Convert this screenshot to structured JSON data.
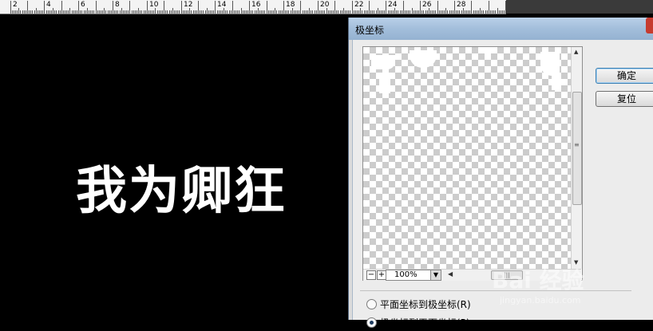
{
  "ruler": {
    "numbers": [
      "2",
      "4",
      "6",
      "8",
      "10",
      "12",
      "14",
      "16",
      "18",
      "20",
      "22",
      "24",
      "26",
      "28"
    ]
  },
  "canvas": {
    "text": "我为卿狂"
  },
  "dialog": {
    "title": "极坐标",
    "zoom_value": "100%",
    "zoom_out_label": "−",
    "zoom_in_label": "+",
    "hscroll_grip": "|||",
    "vscroll_grip": "≡",
    "option_rect_to_polar": "平面坐标到极坐标(R)",
    "option_polar_to_rect": "极坐标到平面坐标(P)",
    "selected_option": "polar_to_rect",
    "ok_label": "确定",
    "reset_label": "复位"
  },
  "watermark": {
    "main": "Bai 经验",
    "sub": "jingyan.baidu.com"
  }
}
